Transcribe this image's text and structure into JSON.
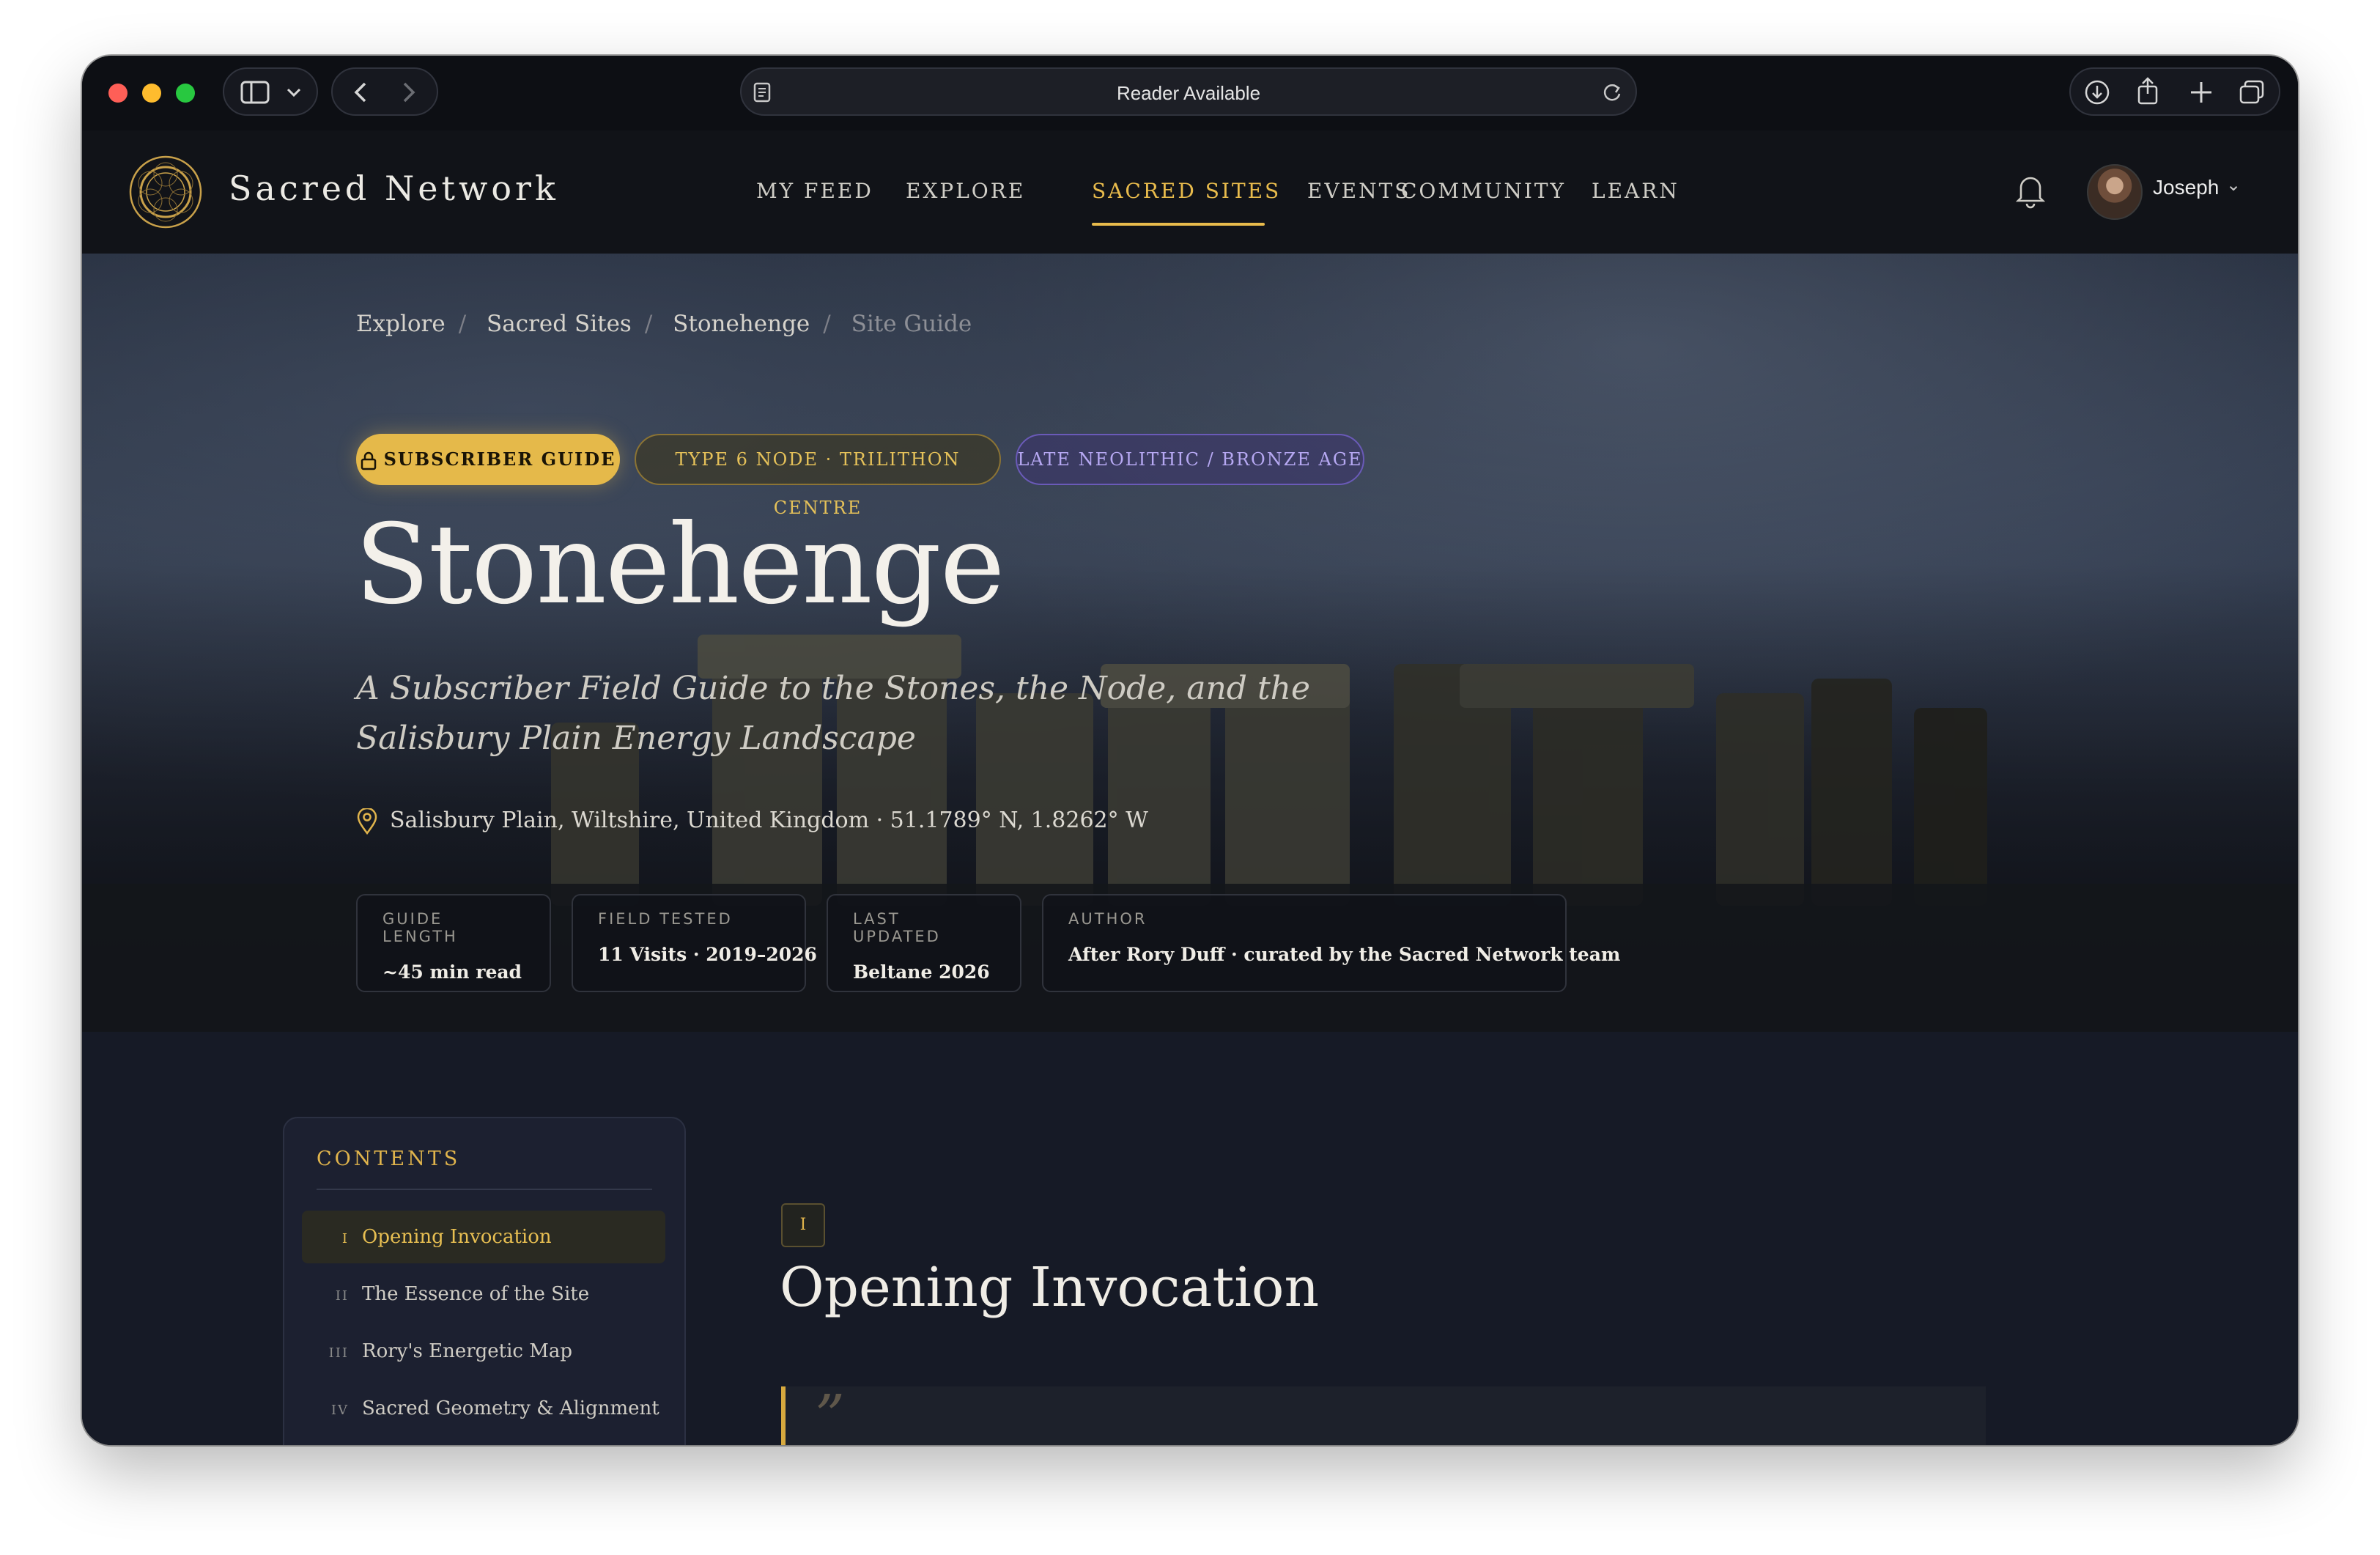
{
  "browser": {
    "address_text": "Reader Available"
  },
  "site": {
    "name": "Sacred Network",
    "nav": [
      {
        "label": "MY FEED"
      },
      {
        "label": "EXPLORE"
      },
      {
        "label": "SACRED SITES",
        "active": true
      },
      {
        "label": "EVENTS"
      },
      {
        "label": "COMMUNITY"
      },
      {
        "label": "LEARN"
      }
    ],
    "user_name": "Joseph",
    "accent_color": "#e8bb4c"
  },
  "hero": {
    "breadcrumb": [
      "Explore",
      "Sacred Sites",
      "Stonehenge",
      "Site Guide"
    ],
    "badges": {
      "subscriber": "SUBSCRIBER GUIDE",
      "type": "TYPE 6 NODE · TRILITHON CENTRE",
      "age": "LATE NEOLITHIC / BRONZE AGE"
    },
    "title": "Stonehenge",
    "subtitle": "A Subscriber Field Guide to the Stones, the Node, and the Salisbury Plain Energy Landscape",
    "location": "Salisbury Plain, Wiltshire, United Kingdom · 51.1789° N, 1.8262° W",
    "meta": [
      {
        "label": "GUIDE LENGTH",
        "value": "~45 min read"
      },
      {
        "label": "FIELD TESTED",
        "value": "11 Visits · 2019–2026"
      },
      {
        "label": "LAST UPDATED",
        "value": "Beltane 2026"
      },
      {
        "label": "AUTHOR",
        "value": "After Rory Duff · curated by the Sacred Network team"
      }
    ]
  },
  "toc": {
    "title": "CONTENTS",
    "items": [
      {
        "num": "I",
        "label": "Opening Invocation",
        "active": true
      },
      {
        "num": "II",
        "label": "The Essence of the Site"
      },
      {
        "num": "III",
        "label": "Rory's Energetic Map"
      },
      {
        "num": "IV",
        "label": "Sacred Geometry & Alignment"
      }
    ]
  },
  "section": {
    "num": "I",
    "title": "Opening Invocation",
    "quote_mark": "”"
  }
}
